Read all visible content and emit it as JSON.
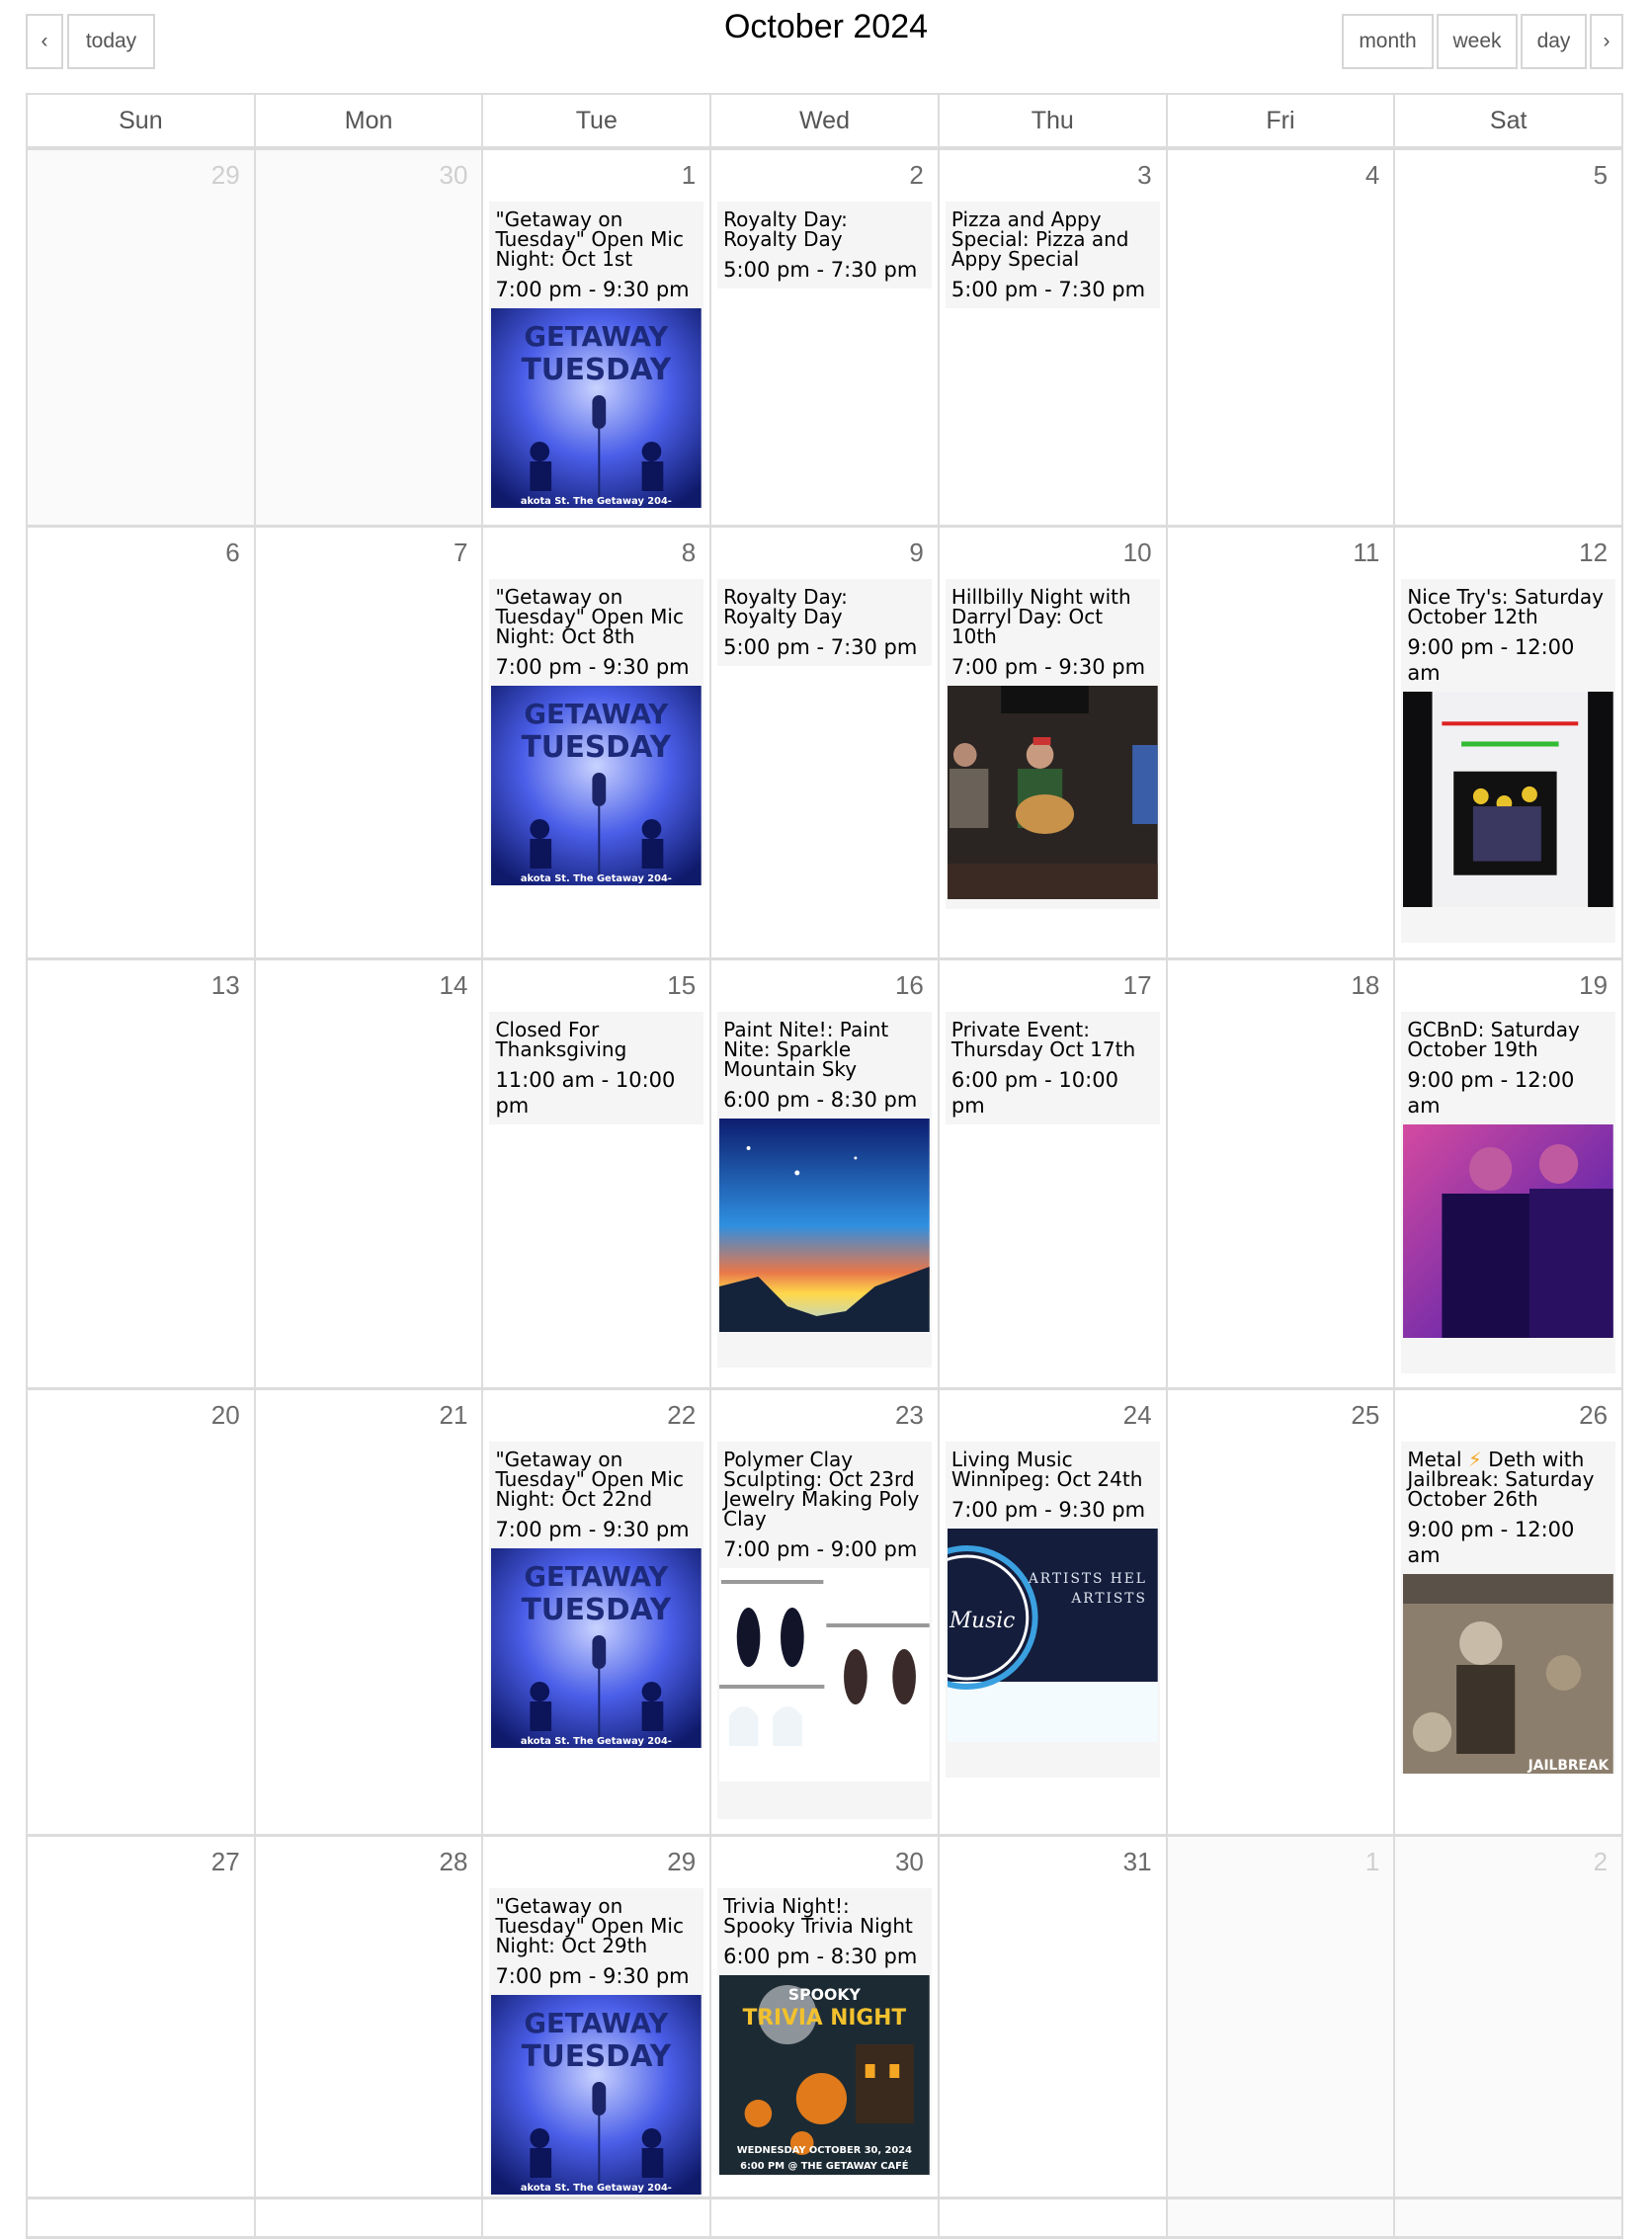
{
  "toolbar": {
    "prev_label": "‹",
    "today_label": "today",
    "title": "October 2024",
    "views": [
      "month",
      "week",
      "day"
    ],
    "next_label": "›"
  },
  "weekdays": [
    "Sun",
    "Mon",
    "Tue",
    "Wed",
    "Thu",
    "Fri",
    "Sat"
  ],
  "weeks": [
    {
      "days": [
        {
          "num": "29",
          "other": true
        },
        {
          "num": "30",
          "other": true
        },
        {
          "num": "1",
          "events": [
            {
              "title": "\"Getaway on Tuesday\" Open Mic Night: Oct 1st",
              "time": "7:00 pm - 9:30 pm",
              "image": "getaway-tuesday-poster"
            }
          ]
        },
        {
          "num": "2",
          "events": [
            {
              "title": "Royalty Day: Royalty Day",
              "time": "5:00 pm - 7:30 pm"
            }
          ]
        },
        {
          "num": "3",
          "events": [
            {
              "title": "Pizza and Appy Special: Pizza and Appy Special",
              "time": "5:00 pm - 7:30 pm"
            }
          ]
        },
        {
          "num": "4"
        },
        {
          "num": "5"
        }
      ]
    },
    {
      "days": [
        {
          "num": "6"
        },
        {
          "num": "7"
        },
        {
          "num": "8",
          "events": [
            {
              "title": "\"Getaway on Tuesday\" Open Mic Night: Oct 8th",
              "time": "7:00 pm - 9:30 pm",
              "image": "getaway-tuesday-poster"
            }
          ]
        },
        {
          "num": "9",
          "events": [
            {
              "title": "Royalty Day: Royalty Day",
              "time": "5:00 pm - 7:30 pm"
            }
          ]
        },
        {
          "num": "10",
          "events": [
            {
              "title": "Hillbilly Night with Darryl Day: Oct 10th",
              "time": "7:00 pm - 9:30 pm",
              "image": "band-photo"
            }
          ]
        },
        {
          "num": "11"
        },
        {
          "num": "12",
          "events": [
            {
              "title": "Nice Try's: Saturday October 12th",
              "time": "9:00 pm - 12:00 am",
              "image": "nice-trys-poster"
            }
          ]
        }
      ]
    },
    {
      "days": [
        {
          "num": "13"
        },
        {
          "num": "14"
        },
        {
          "num": "15",
          "events": [
            {
              "title": "Closed For Thanksgiving",
              "time": "11:00 am - 10:00 pm"
            }
          ]
        },
        {
          "num": "16",
          "events": [
            {
              "title": "Paint Nite!: Paint Nite: Sparkle Mountain Sky",
              "time": "6:00 pm - 8:30 pm",
              "image": "sparkle-mountain-sky-painting"
            }
          ]
        },
        {
          "num": "17",
          "events": [
            {
              "title": "Private Event: Thursday Oct 17th",
              "time": "6:00 pm - 10:00 pm"
            }
          ]
        },
        {
          "num": "18"
        },
        {
          "num": "19",
          "events": [
            {
              "title": "GCBnD: Saturday October 19th",
              "time": "9:00 pm - 12:00 am",
              "image": "gcbnd-band-photo"
            }
          ]
        }
      ]
    },
    {
      "days": [
        {
          "num": "20"
        },
        {
          "num": "21"
        },
        {
          "num": "22",
          "events": [
            {
              "title": "\"Getaway on Tuesday\" Open Mic Night: Oct 22nd",
              "time": "7:00 pm - 9:30 pm",
              "image": "getaway-tuesday-poster"
            }
          ]
        },
        {
          "num": "23",
          "events": [
            {
              "title": "Polymer Clay Sculpting: Oct 23rd Jewelry Making Poly Clay",
              "time": "7:00 pm - 9:00 pm",
              "image": "clay-earrings"
            }
          ]
        },
        {
          "num": "24",
          "events": [
            {
              "title": "Living Music Winnipeg: Oct 24th",
              "time": "7:00 pm - 9:30 pm",
              "image": "living-music-logo"
            }
          ]
        },
        {
          "num": "25"
        },
        {
          "num": "26",
          "events": [
            {
              "title_parts": [
                "Metal",
                "⚡",
                "Deth with Jailbreak: Saturday October 26th"
              ],
              "title": "Metal ⚡ Deth with Jailbreak: Saturday October 26th",
              "time": "9:00 pm - 12:00 am",
              "image": "metal-deth-poster"
            }
          ]
        }
      ]
    },
    {
      "days": [
        {
          "num": "27"
        },
        {
          "num": "28"
        },
        {
          "num": "29",
          "events": [
            {
              "title": "\"Getaway on Tuesday\" Open Mic Night: Oct 29th",
              "time": "7:00 pm - 9:30 pm",
              "image": "getaway-tuesday-poster"
            }
          ]
        },
        {
          "num": "30",
          "events": [
            {
              "title": "Trivia Night!: Spooky Trivia Night",
              "time": "6:00 pm - 8:30 pm",
              "image": "spooky-trivia-poster"
            }
          ]
        },
        {
          "num": "31"
        },
        {
          "num": "1",
          "other": true
        },
        {
          "num": "2",
          "other": true
        }
      ]
    }
  ],
  "image_text": {
    "getaway-tuesday-poster": {
      "line1": "GETAWAY",
      "line2": "TUESDAY",
      "footer": "akota St.   The Getaway   204-"
    },
    "living-music-logo": {
      "line1": "ARTISTS HEL",
      "line2": "ARTISTS",
      "logo": "Music"
    },
    "spooky-trivia-poster": {
      "line1": "SPOOKY",
      "line2": "TRIVIA NIGHT",
      "line3": "WEDNESDAY OCTOBER 30, 2024",
      "line4": "6:00 PM @ THE GETAWAY CAFÉ"
    },
    "metal-deth-poster": {
      "line1": "JAILBREAK"
    }
  },
  "colors": {
    "border": "#dcdcdc",
    "event_bg": "#f5f5f5",
    "other_month_bg": "#fafafa",
    "day_number": "#6b6b6b",
    "other_day_number": "#cfcfcf"
  }
}
